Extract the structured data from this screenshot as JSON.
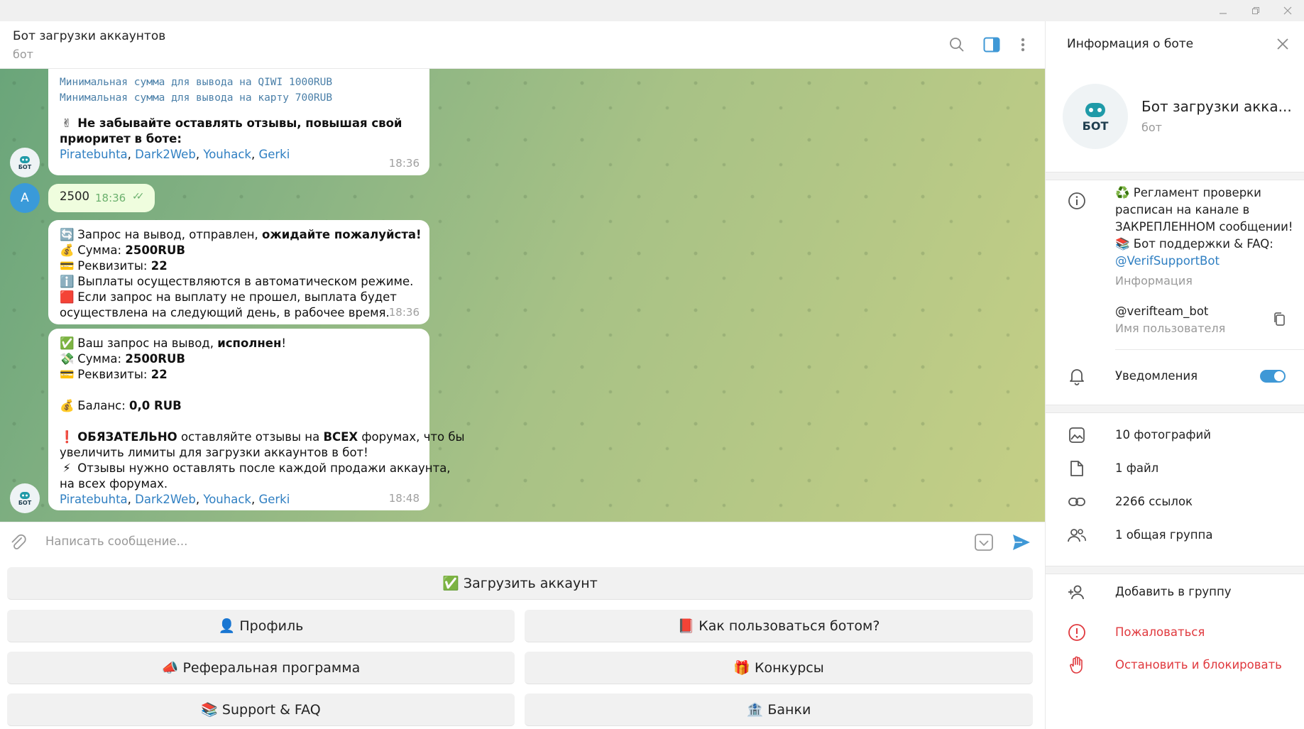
{
  "chat": {
    "title": "Бот загрузки аккаунтов",
    "subtitle": "бот"
  },
  "messages": {
    "m1": {
      "line1": "Минимальная сумма для вывода на QIWI 1000RUB",
      "line2": "Минимальная сумма для вывода на карту 700RUB",
      "emoji3": "✌",
      "line3": "Не забывайте оставлять отзывы, повышая свой",
      "line4": "приоритет в боте:",
      "links": [
        "Piratebuhta",
        "Dark2Web",
        "Youhack",
        "Gerki"
      ],
      "sep": ",",
      "time": "18:36"
    },
    "m2": {
      "avatar_letter": "A",
      "text": "2500",
      "time": "18:36",
      "check": "✓✓"
    },
    "m3": {
      "e1": "🔄",
      "l1a": "Запрос на вывод,  отправлен,",
      "l1b": "ожидайте пожалуйста!",
      "e2": "💰",
      "l2a": "Сумма:",
      "l2b": "2500RUB",
      "e3": "💳",
      "l3a": "Реквизиты:",
      "l3b": "22",
      "e4": "ℹ️",
      "l4": "Выплаты осуществляются в автоматическом режиме.",
      "e5": "🟥",
      "l5": "Если запрос на выплату не прошел, выплата будет",
      "l6": "осуществлена на следующий день, в рабочее время.",
      "time": "18:36"
    },
    "m4": {
      "e1": "✅",
      "l1a": "Ваш запрос на вывод,",
      "l1b": "исполнен",
      "l1c": "!",
      "e2": "💸",
      "l2a": "Сумма:",
      "l2b": "2500RUB",
      "e3": "💳",
      "l3a": "Реквизиты:",
      "l3b": "22",
      "e4": "💰",
      "l4a": "Баланс:",
      "l4b": "0,0 RUB",
      "e5": "❗",
      "l5a": "ОБЯЗАТЕЛЬНО",
      "l5b": "оставляйте отзывы на",
      "l5c": "ВСЕХ",
      "l5d": "форумах, что бы",
      "l6": "увеличить лимиты для загрузки аккаунтов в бот!",
      "e7": "⚡",
      "l7": "Отзывы нужно оставлять после каждой продажи аккаунта,",
      "l8": "на всех форумах.",
      "links": [
        "Piratebuhta",
        "Dark2Web",
        "Youhack",
        "Gerki"
      ],
      "sep": ",",
      "time": "18:48"
    }
  },
  "bot_avatar_text": "БОТ",
  "input": {
    "placeholder": "Написать сообщение..."
  },
  "keyboard": {
    "upload": "✅ Загрузить аккаунт",
    "profile": "👤 Профиль",
    "howto": "📕 Как пользоваться ботом?",
    "referral": "📣 Реферальная программа",
    "contests": "🎁 Конкурсы",
    "support": "📚 Support & FAQ",
    "banks": "🏦 Банки"
  },
  "panel": {
    "title": "Информация о боте",
    "name": "Бот загрузки акка...",
    "sub": "бот",
    "info_line1": "♻️ Регламент проверки",
    "info_line2": "расписан на канале в",
    "info_line3": "ЗАКРЕПЛЕННОМ сообщении!",
    "info_line4": "📚 Бот поддержки & FAQ:",
    "info_link": "@VerifSupportBot",
    "info_label": "Информация",
    "username": "@verifteam_bot",
    "username_label": "Имя пользователя",
    "notifications": "Уведомления",
    "notifications_on": true,
    "photos": "10 фотографий",
    "files": "1 файл",
    "links": "2266 ссылок",
    "groups": "1 общая группа",
    "add_group": "Добавить в группу",
    "report": "Пожаловаться",
    "block": "Остановить и блокировать"
  },
  "colors": {
    "accent": "#3f98d6",
    "link": "#2f7fc2",
    "danger": "#e0393e",
    "outgoing": "#effdde"
  }
}
